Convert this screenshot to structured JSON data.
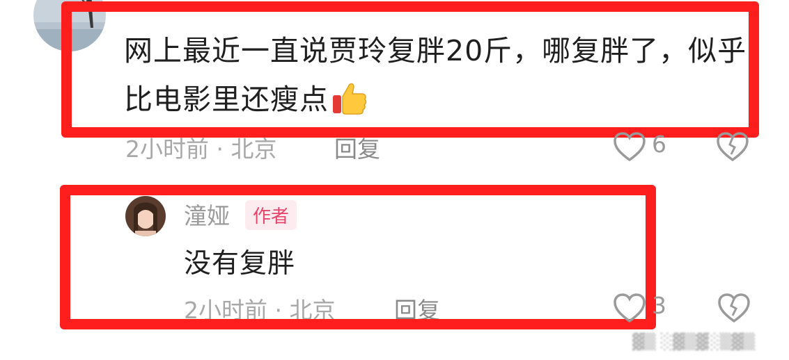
{
  "comment": {
    "text": "网上最近一直说贾玲复胖20斤，哪复胖了，似乎比电影里还瘦点",
    "emoji_icon": "thumbs-up-icon",
    "time_location": "2小时前 · 北京",
    "reply_label": "回复",
    "like_count": "6"
  },
  "reply": {
    "username": "潼娅",
    "badge": "作者",
    "text": "没有复胖",
    "time_location": "2小时前 · 北京",
    "reply_label": "回复",
    "like_count": "3"
  },
  "highlight_color": "#ff1e1e",
  "badge_color": "#e8436a"
}
